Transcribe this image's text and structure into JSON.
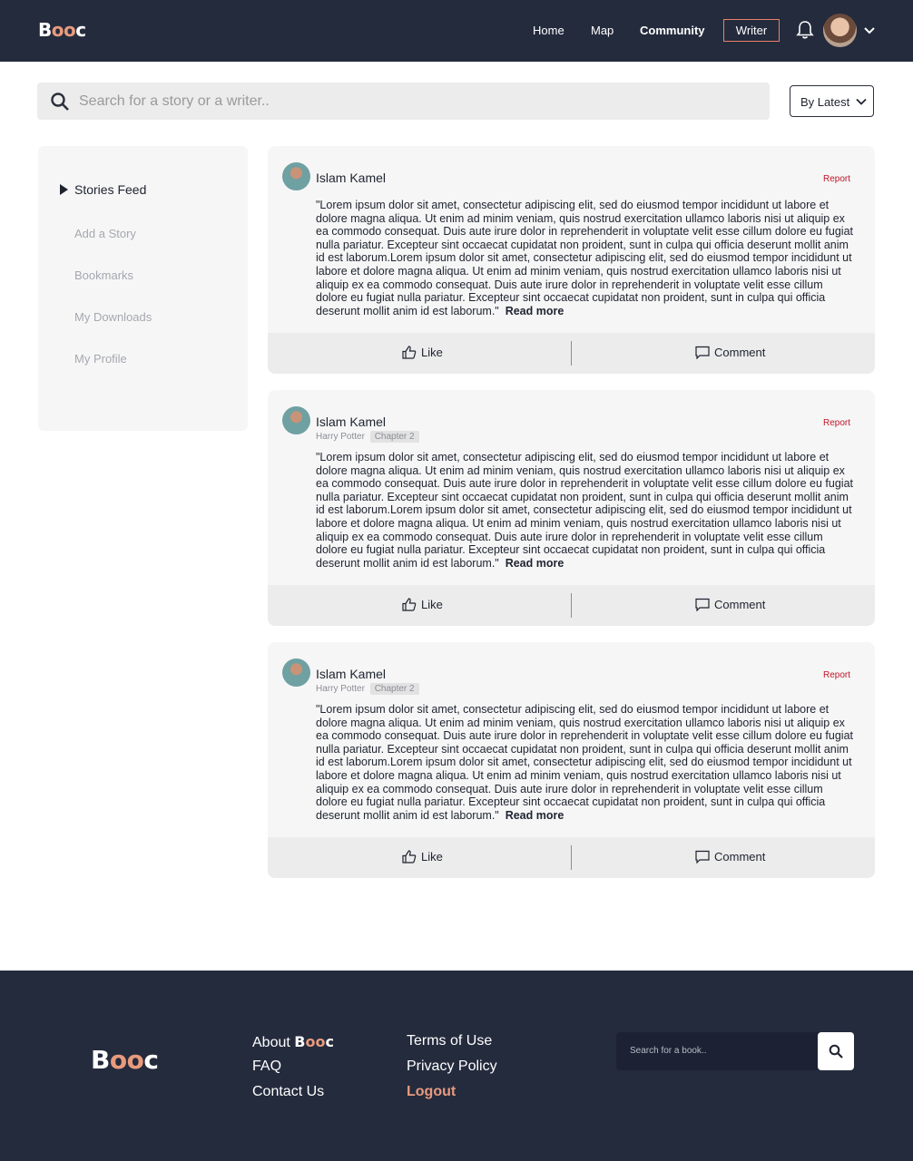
{
  "header": {
    "logo_prefix": "B",
    "logo_mid": "oo",
    "logo_suffix": "c",
    "nav": [
      "Home",
      "Map",
      "Community"
    ],
    "writer_label": "Writer"
  },
  "search": {
    "placeholder": "Search for a story or a writer..",
    "sort_label": "By Latest"
  },
  "sidebar": {
    "active": "Stories Feed",
    "items": [
      "Add a Story",
      "Bookmarks",
      "My Downloads",
      "My Profile"
    ]
  },
  "posts": [
    {
      "author": "Islam Kamel",
      "report": "Report",
      "book": "",
      "chapter": "",
      "text": "\"Lorem ipsum dolor sit amet, consectetur adipiscing elit, sed do eiusmod tempor incididunt ut labore et dolore magna aliqua. Ut enim ad minim veniam, quis nostrud exercitation ullamco laboris nisi ut aliquip ex ea commodo consequat. Duis aute irure dolor in reprehenderit in voluptate velit esse cillum dolore eu fugiat nulla pariatur. Excepteur sint occaecat cupidatat non proident, sunt in culpa qui officia deserunt mollit anim id est laborum.Lorem ipsum dolor sit amet, consectetur adipiscing elit, sed do eiusmod tempor incididunt ut labore et dolore magna aliqua. Ut enim ad minim veniam, quis nostrud exercitation ullamco laboris nisi ut aliquip ex ea commodo consequat. Duis aute irure dolor in reprehenderit in voluptate velit esse cillum dolore eu fugiat nulla pariatur. Excepteur sint occaecat cupidatat non proident, sunt in culpa qui officia deserunt mollit anim id est laborum.\"",
      "read_more": "Read more",
      "like": "Like",
      "comment": "Comment"
    },
    {
      "author": "Islam Kamel",
      "report": "Report",
      "book": "Harry Potter",
      "chapter": "Chapter 2",
      "text": "\"Lorem ipsum dolor sit amet, consectetur adipiscing elit, sed do eiusmod tempor incididunt ut labore et dolore magna aliqua. Ut enim ad minim veniam, quis nostrud exercitation ullamco laboris nisi ut aliquip ex ea commodo consequat. Duis aute irure dolor in reprehenderit in voluptate velit esse cillum dolore eu fugiat nulla pariatur. Excepteur sint occaecat cupidatat non proident, sunt in culpa qui officia deserunt mollit anim id est laborum.Lorem ipsum dolor sit amet, consectetur adipiscing elit, sed do eiusmod tempor incididunt ut labore et dolore magna aliqua. Ut enim ad minim veniam, quis nostrud exercitation ullamco laboris nisi ut aliquip ex ea commodo consequat. Duis aute irure dolor in reprehenderit in voluptate velit esse cillum dolore eu fugiat nulla pariatur. Excepteur sint occaecat cupidatat non proident, sunt in culpa qui officia deserunt mollit anim id est laborum.\"",
      "read_more": "Read more",
      "like": "Like",
      "comment": "Comment"
    },
    {
      "author": "Islam Kamel",
      "report": "Report",
      "book": "Harry Potter",
      "chapter": "Chapter 2",
      "text": "\"Lorem ipsum dolor sit amet, consectetur adipiscing elit, sed do eiusmod tempor incididunt ut labore et dolore magna aliqua. Ut enim ad minim veniam, quis nostrud exercitation ullamco laboris nisi ut aliquip ex ea commodo consequat. Duis aute irure dolor in reprehenderit in voluptate velit esse cillum dolore eu fugiat nulla pariatur. Excepteur sint occaecat cupidatat non proident, sunt in culpa qui officia deserunt mollit anim id est laborum.Lorem ipsum dolor sit amet, consectetur adipiscing elit, sed do eiusmod tempor incididunt ut labore et dolore magna aliqua. Ut enim ad minim veniam, quis nostrud exercitation ullamco laboris nisi ut aliquip ex ea commodo consequat. Duis aute irure dolor in reprehenderit in voluptate velit esse cillum dolore eu fugiat nulla pariatur. Excepteur sint occaecat cupidatat non proident, sunt in culpa qui officia deserunt mollit anim id est laborum.\"",
      "read_more": "Read more",
      "like": "Like",
      "comment": "Comment"
    }
  ],
  "footer": {
    "about_prefix": "About",
    "links_col1": [
      "FAQ",
      "Contact Us"
    ],
    "links_col2": [
      "Terms of Use",
      "Privacy Policy"
    ],
    "logout": "Logout",
    "search_placeholder": "Search for a book.."
  },
  "colors": {
    "navy": "#242b3d",
    "accent": "#e99a7d",
    "report": "#c0162a"
  }
}
